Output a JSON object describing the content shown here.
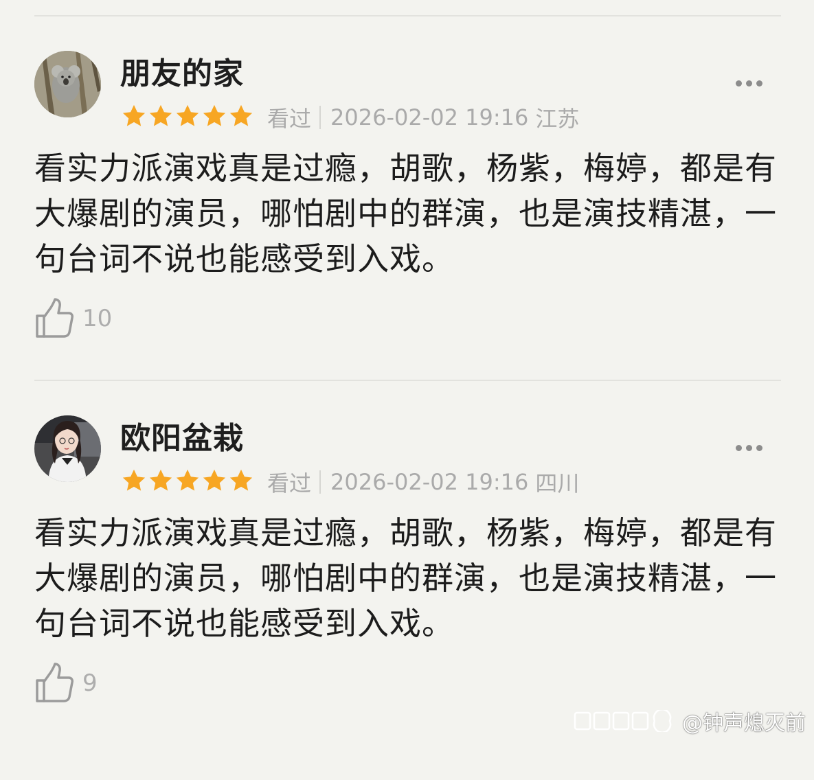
{
  "reviews": [
    {
      "username": "朋友的家",
      "rating": 5,
      "status": "看过",
      "datetime": "2026-02-02 19:16",
      "location": "江苏",
      "text": "看实力派演戏真是过瘾，胡歌，杨紫，梅婷，都是有大爆剧的演员，哪怕剧中的群演，也是演技精湛，一句台词不说也能感受到入戏。",
      "likes": "10"
    },
    {
      "username": "欧阳盆栽",
      "rating": 5,
      "status": "看过",
      "datetime": "2026-02-02 19:16",
      "location": "四川",
      "text": "看实力派演戏真是过瘾，胡歌，杨紫，梅婷，都是有大爆剧的演员，哪怕剧中的群演，也是演技精湛，一句台词不说也能感受到入戏。",
      "likes": "9"
    }
  ],
  "watermark": {
    "text": "@钟声熄灭前"
  },
  "colors": {
    "star": "#f7a623",
    "meta_text": "#aaaaaa",
    "background": "#f3f3ef"
  },
  "icons": {
    "more": "more-icon",
    "like": "thumbs-up-icon",
    "star": "star-icon"
  }
}
